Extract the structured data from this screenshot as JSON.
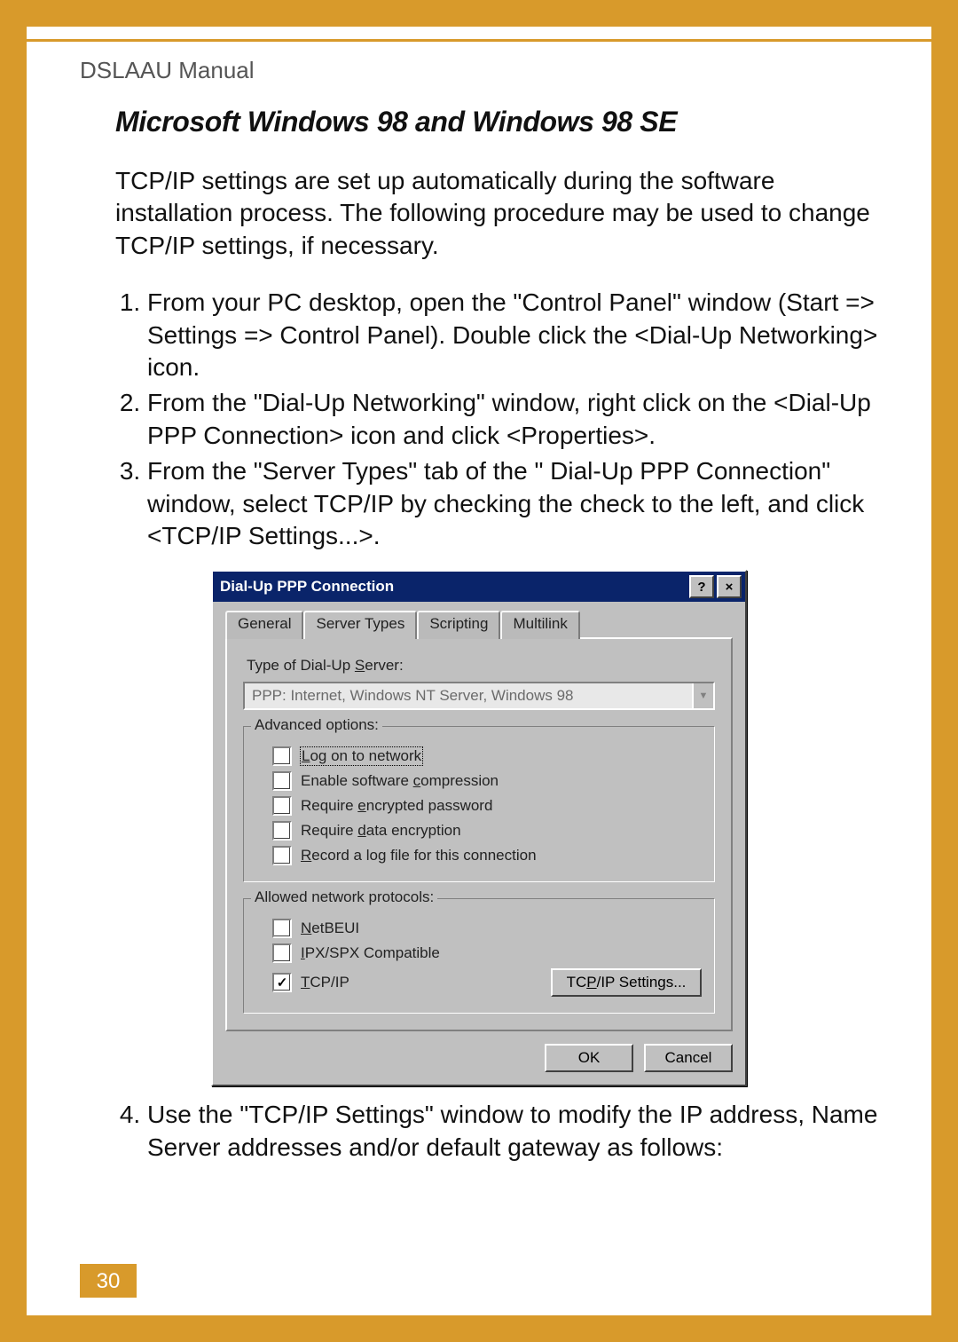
{
  "breadcrumb": "DSLAAU Manual",
  "heading": "Microsoft Windows 98 and Windows 98 SE",
  "intro": "TCP/IP settings are set up automatically during the software installation process. The following procedure may be used to change TCP/IP settings, if necessary.",
  "steps": [
    "From your PC desktop, open the \"Control Panel\" window (Start => Settings => Control Panel). Double click the <Dial-Up Networking> icon.",
    "From the \"Dial-Up Networking\" window, right click on the  <Dial-Up PPP Connection> icon and click <Properties>.",
    "From the \"Server Types\" tab of the \" Dial-Up PPP Connection\" window, select TCP/IP by checking the check to the left, and click <TCP/IP Settings...>."
  ],
  "step4": "Use the \"TCP/IP Settings\" window to modify the IP address, Name Server addresses and/or default gateway as follows:",
  "pageNumber": "30",
  "dialog": {
    "title": "Dial-Up PPP Connection",
    "helpGlyph": "?",
    "closeGlyph": "×",
    "tabs": {
      "general": "General",
      "serverTypes": "Server Types",
      "scripting": "Scripting",
      "multilink": "Multilink"
    },
    "serverTypeLabel": "Type of Dial-Up Server:",
    "serverTypeValue": "PPP: Internet, Windows NT Server, Windows 98",
    "advanced": {
      "legend": "Advanced options:",
      "logon": "Log on to network",
      "compress": "Enable software compression",
      "encpwd": "Require encrypted password",
      "encdata": "Require data encryption",
      "logfile": "Record a log file for this connection"
    },
    "protocols": {
      "legend": "Allowed network protocols:",
      "netbeui": "NetBEUI",
      "ipxspx": "IPX/SPX Compatible",
      "tcpip": "TCP/IP",
      "tcpipSettingsBtn": "TCP/IP Settings..."
    },
    "ok": "OK",
    "cancel": "Cancel"
  }
}
